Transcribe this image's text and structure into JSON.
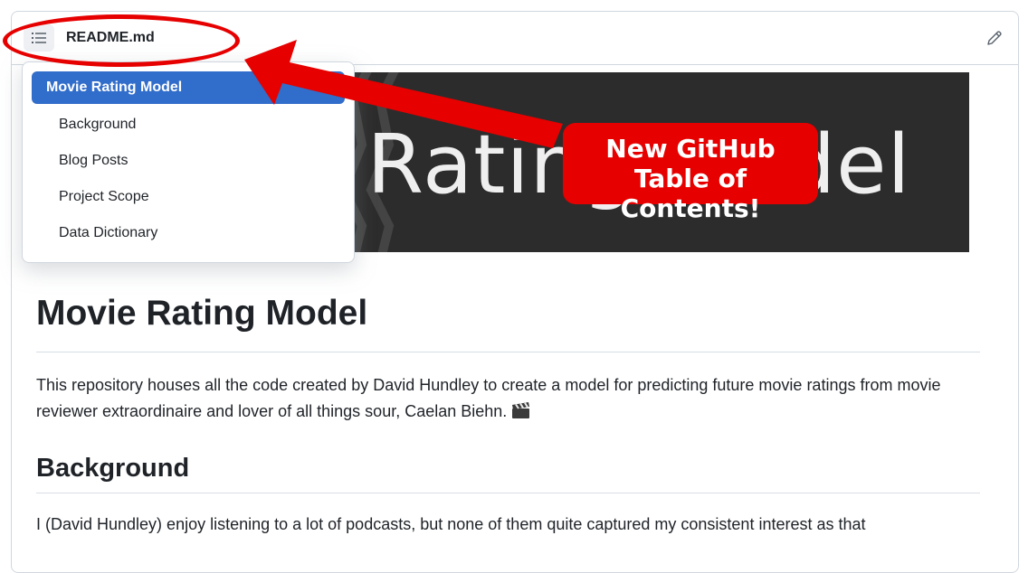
{
  "header": {
    "filename": "README.md",
    "toc_icon": "list-unordered-icon",
    "edit_icon": "pencil-icon"
  },
  "banner": {
    "title": "Movie Rating Model"
  },
  "toc": {
    "items": [
      {
        "label": "Movie Rating Model",
        "active": true
      },
      {
        "label": "Background",
        "active": false
      },
      {
        "label": "Blog Posts",
        "active": false
      },
      {
        "label": "Project Scope",
        "active": false
      },
      {
        "label": "Data Dictionary",
        "active": false
      }
    ]
  },
  "content": {
    "heading": "Movie Rating Model",
    "intro": "This repository houses all the code created by David Hundley to create a model for predicting future movie ratings from movie reviewer extraordinaire and lover of all things sour, Caelan Biehn.",
    "intro_emoji_icon": "clapper-board-icon",
    "section_heading": "Background",
    "section_text": "I (David Hundley) enjoy listening to a lot of podcasts, but none of them quite captured my consistent interest as that"
  },
  "annotation": {
    "line1": "New GitHub",
    "line2": "Table of Contents!",
    "color": "#e60000"
  }
}
